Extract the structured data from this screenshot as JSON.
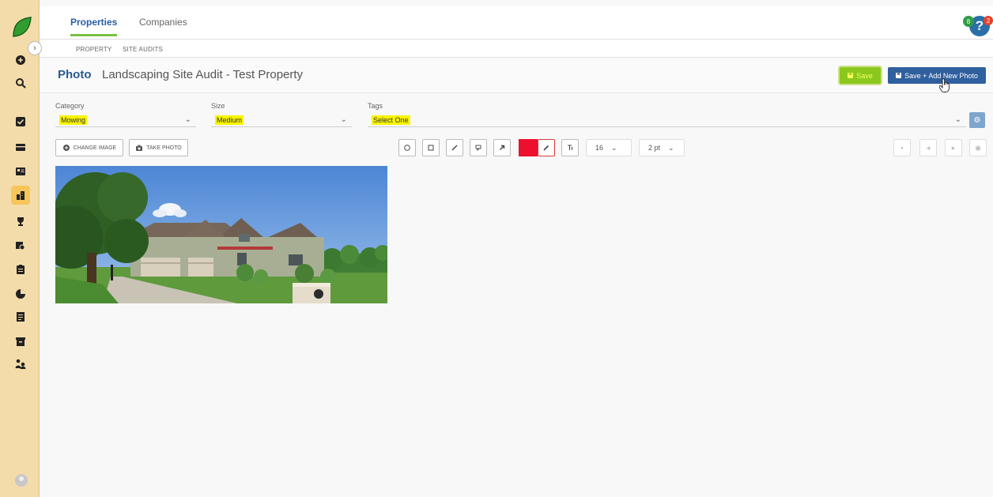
{
  "topnav": {
    "tabs": [
      {
        "label": "Properties",
        "active": true
      },
      {
        "label": "Companies",
        "active": false
      }
    ],
    "subtabs": [
      "PROPERTY",
      "SITE AUDITS"
    ],
    "help_icon": "?",
    "notification_green_count": "8",
    "notification_red_count": "2"
  },
  "header": {
    "title": "Photo",
    "subtitle": "Landscaping Site Audit - Test Property",
    "save_label": "Save",
    "save_new_label": "Save + Add New Photo"
  },
  "form": {
    "category": {
      "label": "Category",
      "value": "Mowing"
    },
    "size": {
      "label": "Size",
      "value": "Medium"
    },
    "tags": {
      "label": "Tags",
      "value": "Select One"
    }
  },
  "toolbar": {
    "change_image_label": "CHANGE IMAGE",
    "take_photo_label": "TAKE PHOTO",
    "font_size": "16",
    "stroke_width": "2 pt",
    "current_color": "#ed0f2e"
  },
  "colors": {
    "sidebar_bg": "#f4dcaa",
    "accent_blue": "#2f5f9e",
    "save_green": "#8bc81e",
    "active_tab_underline": "#79c142"
  },
  "sidebar_icons": [
    "add-circle-icon",
    "search-icon",
    "checkbox-icon",
    "wallet-icon",
    "id-card-icon",
    "building-icon",
    "trophy-icon",
    "truck-icon",
    "clipboard-icon",
    "pie-chart-icon",
    "invoice-icon",
    "archive-icon",
    "team-icon",
    "user-avatar-icon"
  ]
}
